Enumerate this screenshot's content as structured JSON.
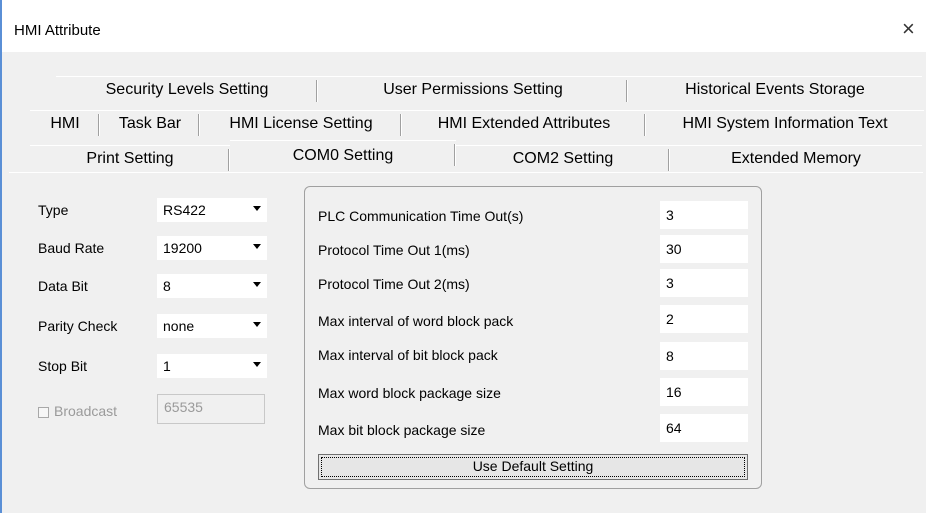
{
  "window": {
    "title": "HMI Attribute",
    "close_glyph": "×"
  },
  "tabs": {
    "row1": [
      "Security Levels Setting",
      "User Permissions Setting",
      "Historical Events Storage"
    ],
    "row2": [
      "HMI",
      "Task Bar",
      "HMI License Setting",
      "HMI Extended Attributes",
      "HMI System Information Text"
    ],
    "row3": [
      "Print Setting",
      "COM0 Setting",
      "COM2 Setting",
      "Extended Memory"
    ],
    "active": "COM0 Setting"
  },
  "com": {
    "type": {
      "label": "Type",
      "value": "RS422"
    },
    "baud": {
      "label": "Baud Rate",
      "value": "19200"
    },
    "databit": {
      "label": "Data Bit",
      "value": "8"
    },
    "parity": {
      "label": "Parity Check",
      "value": "none"
    },
    "stopbit": {
      "label": "Stop Bit",
      "value": "1"
    },
    "broadcast": {
      "label": "Broadcast",
      "value": "65535",
      "checked": false,
      "enabled": false
    }
  },
  "params": [
    {
      "label": "PLC Communication Time Out(s)",
      "value": "3"
    },
    {
      "label": "Protocol Time Out 1(ms)",
      "value": "30"
    },
    {
      "label": "Protocol Time Out 2(ms)",
      "value": "3"
    },
    {
      "label": "Max interval of word block pack",
      "value": "2"
    },
    {
      "label": "Max interval of bit block pack",
      "value": "8"
    },
    {
      "label": "Max word block package size",
      "value": "16"
    },
    {
      "label": "Max bit block package size",
      "value": "64"
    }
  ],
  "default_button_label": "Use Default Setting"
}
